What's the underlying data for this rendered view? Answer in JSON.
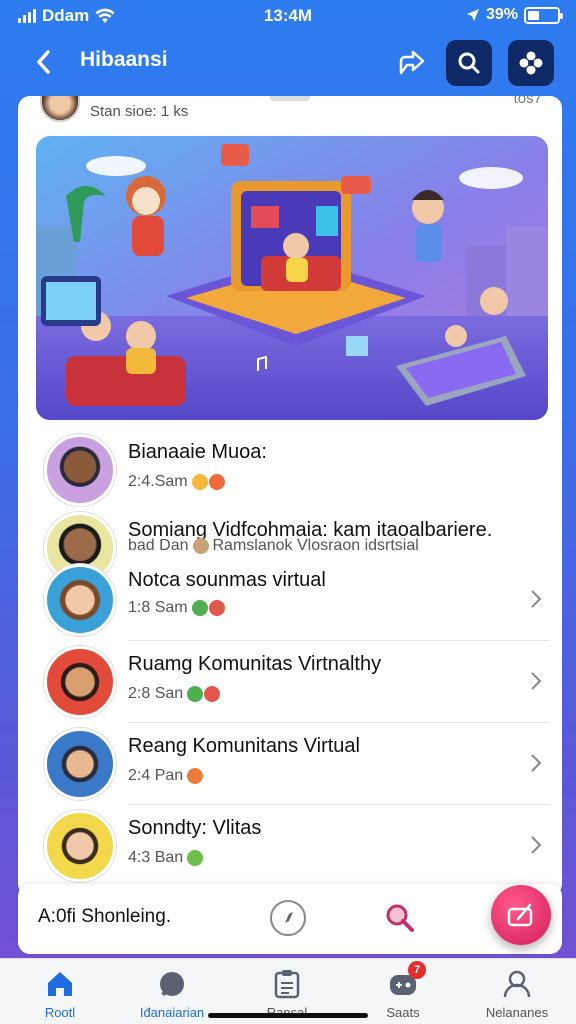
{
  "status_bar": {
    "carrier": "Ddam",
    "time": "13:4M",
    "battery": "39%",
    "battery_level": 0.39
  },
  "header": {
    "title": "Hibaansi",
    "icons": [
      "back-arrow-icon",
      "share-icon",
      "search-icon",
      "settings-icon"
    ]
  },
  "card": {
    "top_text": "Stan sioe: 1 ks",
    "top_right": "tos7"
  },
  "list": [
    {
      "name": "Bianaaie Muoa:",
      "time": "2:4.Sam",
      "emoji_colors": [
        "#f3b93a",
        "#f06a3a"
      ],
      "chevron": false
    },
    {
      "name": "Somiang Vidfcohmaia: kam itaoalbariere.",
      "time": "bad Dan",
      "detail": "Ramslanok Vlosraon idsrtsial",
      "emoji_colors": [
        "#c9a27a"
      ],
      "chevron": false
    },
    {
      "name": "Notca sounmas virtual",
      "time": "1:8 Sam",
      "emoji_colors": [
        "#4caf50",
        "#e2574c"
      ],
      "chevron": true
    },
    {
      "name": "Ruamg Komunitas Virtnalthy",
      "time": "2:8 San",
      "emoji_colors": [
        "#4caf50",
        "#e2574c"
      ],
      "chevron": true
    },
    {
      "name": "Reang Komunitans Virtual",
      "time": "2:4 Pan",
      "emoji_colors": [
        "#f07c3a"
      ],
      "chevron": true
    },
    {
      "name": "Sonndty: Vlitas",
      "time": "4:3 Ban",
      "emoji_colors": [
        "#6bbf4a"
      ],
      "chevron": true
    }
  ],
  "composer": {
    "text": "A:0fi Shonleing."
  },
  "tabs": [
    {
      "label": "Rootl",
      "icon": "home-icon",
      "active": true
    },
    {
      "label": "Iđanaiarian",
      "icon": "chat-icon",
      "active": false
    },
    {
      "label": "Ransal",
      "icon": "clipboard-icon",
      "active": false
    },
    {
      "label": "Saats",
      "icon": "game-icon",
      "badge": "7",
      "active": false
    },
    {
      "label": "Nelananes",
      "icon": "profile-icon",
      "active": false
    }
  ]
}
